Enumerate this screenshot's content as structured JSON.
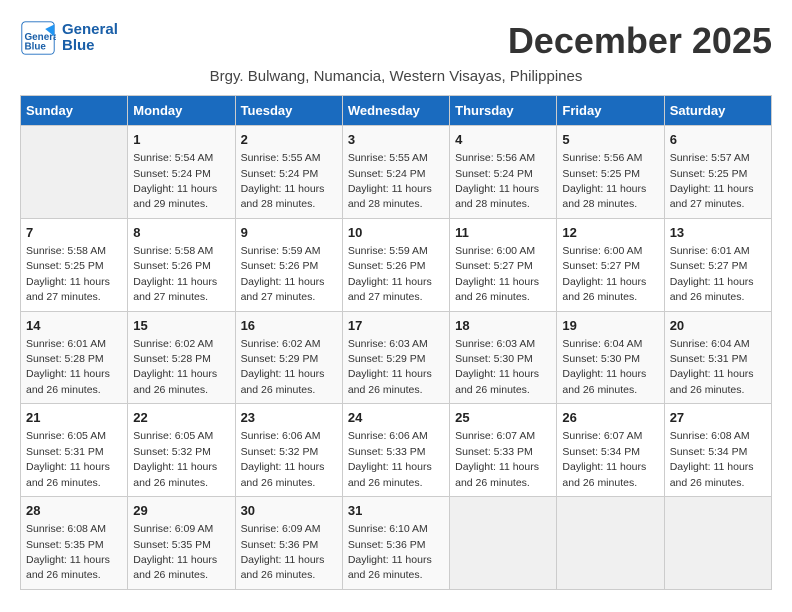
{
  "logo": {
    "line1": "General",
    "line2": "Blue"
  },
  "title": "December 2025",
  "subtitle": "Brgy. Bulwang, Numancia, Western Visayas, Philippines",
  "days_of_week": [
    "Sunday",
    "Monday",
    "Tuesday",
    "Wednesday",
    "Thursday",
    "Friday",
    "Saturday"
  ],
  "weeks": [
    [
      {
        "day": "",
        "sunrise": "",
        "sunset": "",
        "daylight": ""
      },
      {
        "day": "1",
        "sunrise": "Sunrise: 5:54 AM",
        "sunset": "Sunset: 5:24 PM",
        "daylight": "Daylight: 11 hours and 29 minutes."
      },
      {
        "day": "2",
        "sunrise": "Sunrise: 5:55 AM",
        "sunset": "Sunset: 5:24 PM",
        "daylight": "Daylight: 11 hours and 28 minutes."
      },
      {
        "day": "3",
        "sunrise": "Sunrise: 5:55 AM",
        "sunset": "Sunset: 5:24 PM",
        "daylight": "Daylight: 11 hours and 28 minutes."
      },
      {
        "day": "4",
        "sunrise": "Sunrise: 5:56 AM",
        "sunset": "Sunset: 5:24 PM",
        "daylight": "Daylight: 11 hours and 28 minutes."
      },
      {
        "day": "5",
        "sunrise": "Sunrise: 5:56 AM",
        "sunset": "Sunset: 5:25 PM",
        "daylight": "Daylight: 11 hours and 28 minutes."
      },
      {
        "day": "6",
        "sunrise": "Sunrise: 5:57 AM",
        "sunset": "Sunset: 5:25 PM",
        "daylight": "Daylight: 11 hours and 27 minutes."
      }
    ],
    [
      {
        "day": "7",
        "sunrise": "Sunrise: 5:58 AM",
        "sunset": "Sunset: 5:25 PM",
        "daylight": "Daylight: 11 hours and 27 minutes."
      },
      {
        "day": "8",
        "sunrise": "Sunrise: 5:58 AM",
        "sunset": "Sunset: 5:26 PM",
        "daylight": "Daylight: 11 hours and 27 minutes."
      },
      {
        "day": "9",
        "sunrise": "Sunrise: 5:59 AM",
        "sunset": "Sunset: 5:26 PM",
        "daylight": "Daylight: 11 hours and 27 minutes."
      },
      {
        "day": "10",
        "sunrise": "Sunrise: 5:59 AM",
        "sunset": "Sunset: 5:26 PM",
        "daylight": "Daylight: 11 hours and 27 minutes."
      },
      {
        "day": "11",
        "sunrise": "Sunrise: 6:00 AM",
        "sunset": "Sunset: 5:27 PM",
        "daylight": "Daylight: 11 hours and 26 minutes."
      },
      {
        "day": "12",
        "sunrise": "Sunrise: 6:00 AM",
        "sunset": "Sunset: 5:27 PM",
        "daylight": "Daylight: 11 hours and 26 minutes."
      },
      {
        "day": "13",
        "sunrise": "Sunrise: 6:01 AM",
        "sunset": "Sunset: 5:27 PM",
        "daylight": "Daylight: 11 hours and 26 minutes."
      }
    ],
    [
      {
        "day": "14",
        "sunrise": "Sunrise: 6:01 AM",
        "sunset": "Sunset: 5:28 PM",
        "daylight": "Daylight: 11 hours and 26 minutes."
      },
      {
        "day": "15",
        "sunrise": "Sunrise: 6:02 AM",
        "sunset": "Sunset: 5:28 PM",
        "daylight": "Daylight: 11 hours and 26 minutes."
      },
      {
        "day": "16",
        "sunrise": "Sunrise: 6:02 AM",
        "sunset": "Sunset: 5:29 PM",
        "daylight": "Daylight: 11 hours and 26 minutes."
      },
      {
        "day": "17",
        "sunrise": "Sunrise: 6:03 AM",
        "sunset": "Sunset: 5:29 PM",
        "daylight": "Daylight: 11 hours and 26 minutes."
      },
      {
        "day": "18",
        "sunrise": "Sunrise: 6:03 AM",
        "sunset": "Sunset: 5:30 PM",
        "daylight": "Daylight: 11 hours and 26 minutes."
      },
      {
        "day": "19",
        "sunrise": "Sunrise: 6:04 AM",
        "sunset": "Sunset: 5:30 PM",
        "daylight": "Daylight: 11 hours and 26 minutes."
      },
      {
        "day": "20",
        "sunrise": "Sunrise: 6:04 AM",
        "sunset": "Sunset: 5:31 PM",
        "daylight": "Daylight: 11 hours and 26 minutes."
      }
    ],
    [
      {
        "day": "21",
        "sunrise": "Sunrise: 6:05 AM",
        "sunset": "Sunset: 5:31 PM",
        "daylight": "Daylight: 11 hours and 26 minutes."
      },
      {
        "day": "22",
        "sunrise": "Sunrise: 6:05 AM",
        "sunset": "Sunset: 5:32 PM",
        "daylight": "Daylight: 11 hours and 26 minutes."
      },
      {
        "day": "23",
        "sunrise": "Sunrise: 6:06 AM",
        "sunset": "Sunset: 5:32 PM",
        "daylight": "Daylight: 11 hours and 26 minutes."
      },
      {
        "day": "24",
        "sunrise": "Sunrise: 6:06 AM",
        "sunset": "Sunset: 5:33 PM",
        "daylight": "Daylight: 11 hours and 26 minutes."
      },
      {
        "day": "25",
        "sunrise": "Sunrise: 6:07 AM",
        "sunset": "Sunset: 5:33 PM",
        "daylight": "Daylight: 11 hours and 26 minutes."
      },
      {
        "day": "26",
        "sunrise": "Sunrise: 6:07 AM",
        "sunset": "Sunset: 5:34 PM",
        "daylight": "Daylight: 11 hours and 26 minutes."
      },
      {
        "day": "27",
        "sunrise": "Sunrise: 6:08 AM",
        "sunset": "Sunset: 5:34 PM",
        "daylight": "Daylight: 11 hours and 26 minutes."
      }
    ],
    [
      {
        "day": "28",
        "sunrise": "Sunrise: 6:08 AM",
        "sunset": "Sunset: 5:35 PM",
        "daylight": "Daylight: 11 hours and 26 minutes."
      },
      {
        "day": "29",
        "sunrise": "Sunrise: 6:09 AM",
        "sunset": "Sunset: 5:35 PM",
        "daylight": "Daylight: 11 hours and 26 minutes."
      },
      {
        "day": "30",
        "sunrise": "Sunrise: 6:09 AM",
        "sunset": "Sunset: 5:36 PM",
        "daylight": "Daylight: 11 hours and 26 minutes."
      },
      {
        "day": "31",
        "sunrise": "Sunrise: 6:10 AM",
        "sunset": "Sunset: 5:36 PM",
        "daylight": "Daylight: 11 hours and 26 minutes."
      },
      {
        "day": "",
        "sunrise": "",
        "sunset": "",
        "daylight": ""
      },
      {
        "day": "",
        "sunrise": "",
        "sunset": "",
        "daylight": ""
      },
      {
        "day": "",
        "sunrise": "",
        "sunset": "",
        "daylight": ""
      }
    ]
  ]
}
